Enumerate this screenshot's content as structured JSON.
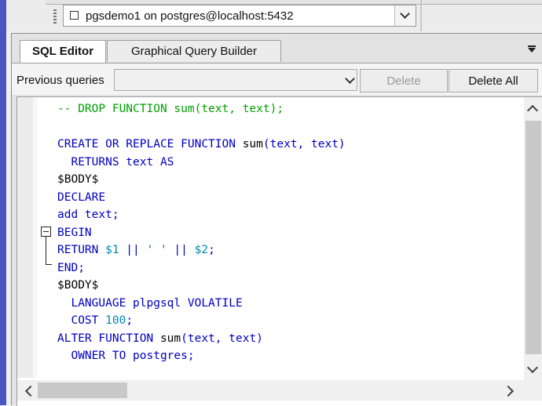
{
  "connection": {
    "label": "pgsdemo1 on postgres@localhost:5432"
  },
  "tabs": [
    {
      "label": "SQL Editor",
      "active": true
    },
    {
      "label": "Graphical Query Builder",
      "active": false
    }
  ],
  "previous_queries": {
    "label": "Previous queries",
    "selected": "",
    "delete_label": "Delete",
    "delete_all_label": "Delete All"
  },
  "editor": {
    "lines": [
      [
        {
          "t": "-- DROP FUNCTION sum(text, text);",
          "c": "com"
        }
      ],
      [
        {
          "t": "",
          "c": "kw"
        }
      ],
      [
        {
          "t": "CREATE OR REPLACE FUNCTION ",
          "c": "kw"
        },
        {
          "t": "sum",
          "c": "plain"
        },
        {
          "t": "(text, text)",
          "c": "kw"
        }
      ],
      [
        {
          "t": "  RETURNS text AS",
          "c": "kw"
        }
      ],
      [
        {
          "t": "$BODY$",
          "c": "plain"
        }
      ],
      [
        {
          "t": "DECLARE",
          "c": "kw"
        }
      ],
      [
        {
          "t": "add text;",
          "c": "kw"
        }
      ],
      [
        {
          "t": "BEGIN",
          "c": "kw"
        }
      ],
      [
        {
          "t": "RETURN ",
          "c": "kw"
        },
        {
          "t": "$1",
          "c": "num"
        },
        {
          "t": " || ",
          "c": "kw"
        },
        {
          "t": "' '",
          "c": "str"
        },
        {
          "t": " || ",
          "c": "kw"
        },
        {
          "t": "$2",
          "c": "num"
        },
        {
          "t": ";",
          "c": "kw"
        }
      ],
      [
        {
          "t": "END;",
          "c": "kw"
        }
      ],
      [
        {
          "t": "$BODY$",
          "c": "plain"
        }
      ],
      [
        {
          "t": "  LANGUAGE plpgsql VOLATILE",
          "c": "kw"
        }
      ],
      [
        {
          "t": "  COST ",
          "c": "kw"
        },
        {
          "t": "100",
          "c": "num"
        },
        {
          "t": ";",
          "c": "kw"
        }
      ],
      [
        {
          "t": "ALTER FUNCTION ",
          "c": "kw"
        },
        {
          "t": "sum",
          "c": "plain"
        },
        {
          "t": "(text, text)",
          "c": "kw"
        }
      ],
      [
        {
          "t": "  OWNER TO postgres;",
          "c": "kw"
        }
      ]
    ]
  },
  "colors": {
    "keyword": "#0000c0",
    "comment": "#00a000",
    "number": "#0088aa",
    "accent_left": "#4a56c0"
  }
}
